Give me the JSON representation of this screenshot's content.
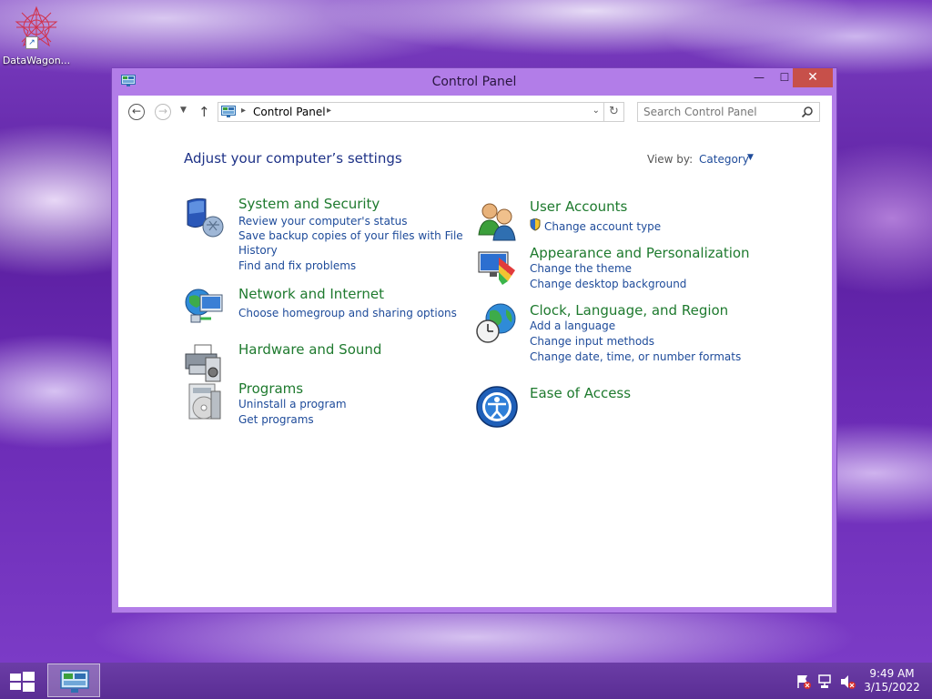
{
  "desktop": {
    "icons": [
      {
        "label": "DataWagon..."
      }
    ]
  },
  "window": {
    "title": "Control Panel",
    "buttons": {
      "minimize": "—",
      "maximize": "☐",
      "close": "✕"
    }
  },
  "addressbar": {
    "crumb": "Control Panel",
    "search_placeholder": "Search Control Panel"
  },
  "content": {
    "heading": "Adjust your computer’s settings",
    "view_by_label": "View by:",
    "view_by_value": "Category",
    "left_categories": [
      {
        "title": "System and Security",
        "icon": "shield-icon",
        "links": [
          "Review your computer's status",
          "Save backup copies of your files with File",
          "History",
          "Find and fix problems"
        ]
      },
      {
        "title": "Network and Internet",
        "icon": "network-globe-icon",
        "links": [
          "Choose homegroup and sharing options"
        ]
      },
      {
        "title": "Hardware and Sound",
        "icon": "printer-icon",
        "links": []
      },
      {
        "title": "Programs",
        "icon": "programs-disc-icon",
        "links": [
          "Uninstall a program",
          "Get programs"
        ]
      }
    ],
    "right_categories": [
      {
        "title": "User Accounts",
        "icon": "users-icon",
        "links": [
          "Change account type"
        ]
      },
      {
        "title": "Appearance and Personalization",
        "icon": "monitor-palette-icon",
        "links": [
          "Change the theme",
          "Change desktop background"
        ]
      },
      {
        "title": "Clock, Language, and Region",
        "icon": "globe-clock-icon",
        "links": [
          "Add a language",
          "Change input methods",
          "Change date, time, or number formats"
        ]
      },
      {
        "title": "Ease of Access",
        "icon": "ease-of-access-icon",
        "links": []
      }
    ]
  },
  "taskbar": {
    "time": "9:49 AM",
    "date": "3/15/2022"
  },
  "colors": {
    "category_title": "#1e7a2e",
    "link": "#1e4b9a",
    "heading": "#1e3287",
    "window_frame": "#b27de8",
    "close_button": "#c7504a"
  }
}
